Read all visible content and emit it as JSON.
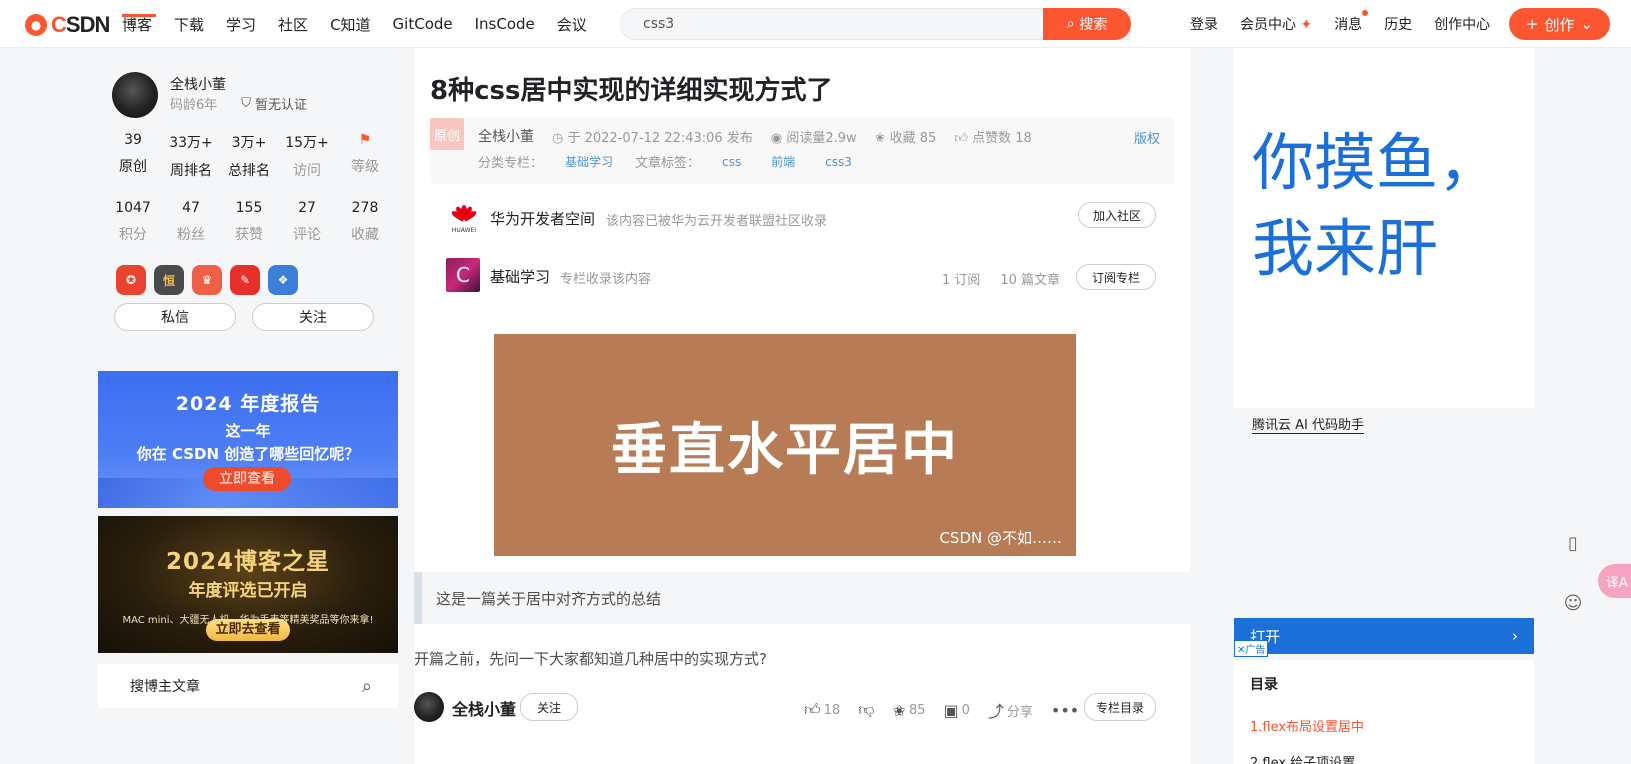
{
  "brand": {
    "logo_text_pre": "C",
    "logo_text": "SDN",
    "accent": "#fc5531"
  },
  "nav": {
    "items": [
      "博客",
      "下载",
      "学习",
      "社区",
      "C知道",
      "GitCode",
      "InsCode",
      "会议"
    ],
    "search_query": "css3",
    "search_button": "搜索",
    "right_items": [
      "登录",
      "会员中心",
      "消息",
      "历史",
      "创作中心"
    ],
    "create_button": "创作"
  },
  "profile": {
    "name": "全栈小董",
    "age": "码龄6年",
    "verify": "暂无认证",
    "stats1": [
      {
        "num": "39",
        "label": "原创"
      },
      {
        "num": "33万+",
        "label": "周排名"
      },
      {
        "num": "3万+",
        "label": "总排名"
      },
      {
        "num": "15万+",
        "label": "访问"
      },
      {
        "num": "",
        "label": "等级"
      }
    ],
    "stats2": [
      {
        "num": "1047",
        "label": "积分"
      },
      {
        "num": "47",
        "label": "粉丝"
      },
      {
        "num": "155",
        "label": "获赞"
      },
      {
        "num": "27",
        "label": "评论"
      },
      {
        "num": "278",
        "label": "收藏"
      }
    ],
    "message_button": "私信",
    "follow_button": "关注"
  },
  "banner1": {
    "line1": "2024 年度报告",
    "line2": "这一年",
    "line3": "你在 CSDN 创造了哪些回忆呢？",
    "button": "立即查看"
  },
  "banner2": {
    "line1": "2024博客之星",
    "line2": "年度评选已开启",
    "line3": "MAC mini、大疆无人机、华为手表等精美奖品等你来拿!",
    "button": "立即去查看"
  },
  "blog_search": {
    "placeholder": "搜博主文章"
  },
  "article": {
    "title": "8种css居中实现的详细实现方式了",
    "orig_tag": "原创",
    "author": "全栈小董",
    "date": "于 2022-07-12 22:43:06 发布",
    "reads": "阅读量2.9w",
    "favorites": "收藏 85",
    "likes": "点赞数 18",
    "copyright": "版权",
    "category_label": "分类专栏：",
    "category": "基础学习",
    "tags_label": "文章标签：",
    "tags": [
      "css",
      "前端",
      "css3"
    ]
  },
  "community": {
    "name": "华为开发者空间",
    "desc": "该内容已被华为云开发者联盟社区收录",
    "button": "加入社区",
    "logo_text": "HUAWEI"
  },
  "column": {
    "name": "基础学习",
    "desc": "专栏收录该内容",
    "subs": "1 订阅",
    "count": "10 篇文章",
    "button": "订阅专栏",
    "cover_letter": "C"
  },
  "hero": {
    "text": "垂直水平居中",
    "watermark": "CSDN @不如……"
  },
  "quote": "这是一篇关于居中对齐方式的总结",
  "paragraph": "开篇之前，先问一下大家都知道几种居中的实现方式?",
  "bottom_bar": {
    "author": "全栈小董",
    "follow": "关注",
    "likes": "18",
    "favorites": "85",
    "comments": "0",
    "share": "分享",
    "more": "•••",
    "toc_button": "专栏目录"
  },
  "right_ad": {
    "big_text": "你摸鱼，我来肝",
    "link": "腾讯云 AI 代码助手",
    "open": "打开",
    "ad_tag": "广告"
  },
  "toc": {
    "title": "目录",
    "items": [
      "1.flex布局设置居中",
      "2.flex 给子项设置"
    ]
  },
  "translate": "译A"
}
